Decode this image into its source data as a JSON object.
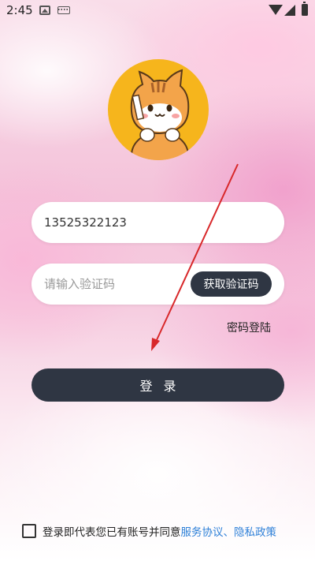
{
  "status_bar": {
    "time": "2:45",
    "icons": [
      "image-icon",
      "keyboard-icon",
      "wifi-icon",
      "signal-icon",
      "battery-icon"
    ]
  },
  "logo": {
    "icon": "cat-mascot-icon"
  },
  "phone_input": {
    "value": "13525322123",
    "placeholder": ""
  },
  "code_input": {
    "value": "",
    "placeholder": "请输入验证码"
  },
  "get_code_button": {
    "label": "获取验证码"
  },
  "password_login": {
    "label": "密码登陆"
  },
  "login_button": {
    "label": "登录"
  },
  "agreement": {
    "text": "登录即代表您已有账号并同意",
    "terms_link": "服务协议",
    "separator": "、",
    "privacy_link": "隐私政策"
  },
  "colors": {
    "primary_dark": "#2f3643",
    "link": "#2f80d8",
    "logo_bg": "#f6b51c",
    "annotation_arrow": "#d8282a"
  }
}
